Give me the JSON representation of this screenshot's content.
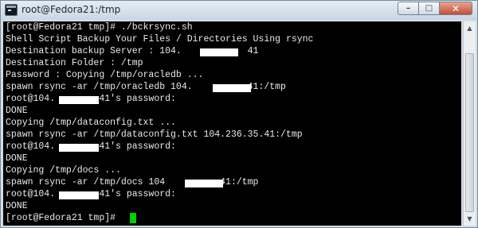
{
  "window": {
    "title": "root@Fedora21:/tmp",
    "controls": {
      "minimize": "–",
      "maximize": "□",
      "close": "✕"
    }
  },
  "terminal": {
    "lines": [
      "[root@Fedora21 tmp]# ./bckrsync.sh",
      "Shell Script Backup Your Files / Directories Using rsync",
      "Destination backup Server : 104.            41",
      "Destination Folder : /tmp",
      "Password : Copying /tmp/oracledb ...",
      "spawn rsync -ar /tmp/oracledb 104.          41:/tmp",
      "root@104.        41's password:",
      "DONE",
      "Copying /tmp/dataconfig.txt ...",
      "spawn rsync -ar /tmp/dataconfig.txt 104.236.35.41:/tmp",
      "root@104.        41's password:",
      "DONE",
      "Copying /tmp/docs ...",
      "spawn rsync -ar /tmp/docs 104          41:/tmp",
      "root@104.        41's password:",
      "DONE",
      "[root@Fedora21 tmp]# "
    ],
    "text_color": "#eaeaea",
    "background": "#000000",
    "cursor_color": "#00d000"
  },
  "scrollbar": {
    "up_icon": "up-arrow-icon",
    "down_icon": "down-arrow-icon"
  }
}
